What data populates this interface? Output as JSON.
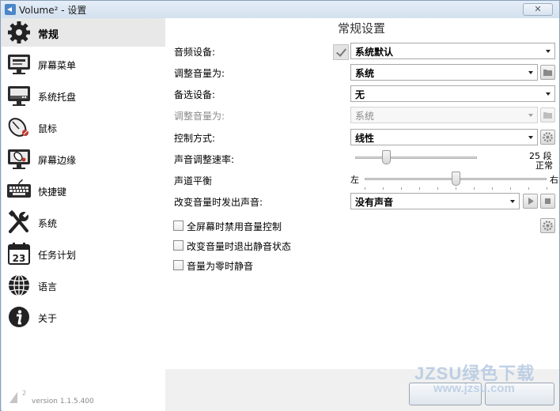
{
  "window": {
    "title": "Volume² - 设置"
  },
  "sidebar": {
    "items": [
      {
        "label": "常规",
        "icon": "gear-icon"
      },
      {
        "label": "屏幕菜单",
        "icon": "monitor-menu-icon"
      },
      {
        "label": "系统托盘",
        "icon": "system-tray-icon"
      },
      {
        "label": "鼠标",
        "icon": "mouse-icon"
      },
      {
        "label": "屏幕边缘",
        "icon": "screen-edge-icon"
      },
      {
        "label": "快捷键",
        "icon": "keyboard-icon"
      },
      {
        "label": "系统",
        "icon": "wrench-screwdriver-icon"
      },
      {
        "label": "任务计划",
        "icon": "calendar-icon"
      },
      {
        "label": "语言",
        "icon": "globe-icon"
      },
      {
        "label": "关于",
        "icon": "info-icon"
      }
    ],
    "calendar_day": "23",
    "version": "version 1.1.5.400",
    "version_mark": "2"
  },
  "main": {
    "title": "常规设置",
    "audio_device": {
      "label": "音频设备:",
      "value": "系统默认"
    },
    "adjust_volume": {
      "label": "调整音量为:",
      "value": "系统"
    },
    "backup_device": {
      "label": "备选设备:",
      "value": "无"
    },
    "adjust_volume_disabled": {
      "label": "调整音量为:",
      "value": "系统"
    },
    "control_mode": {
      "label": "控制方式:",
      "value": "线性"
    },
    "volume_speed": {
      "label": "声音调整速率:",
      "value_text": "25 段",
      "level": 0.25
    },
    "balance": {
      "label": "声道平衡",
      "left": "左",
      "right": "右",
      "center_text": "正常",
      "level": 0.5
    },
    "change_sound": {
      "label": "改变音量时发出声音:",
      "value": "没有声音"
    },
    "checkboxes": [
      {
        "label": "全屏幕时禁用音量控制",
        "checked": false
      },
      {
        "label": "改变音量时退出静音状态",
        "checked": false
      },
      {
        "label": "音量为零时静音",
        "checked": false
      }
    ]
  },
  "watermark": {
    "line1": "JZSU绿色下载",
    "line2": "www.jzsu.com"
  },
  "colors": {
    "frame": "#dbe6f1",
    "active_nav": "#e8e8e8",
    "accent": "#4a86c8"
  }
}
